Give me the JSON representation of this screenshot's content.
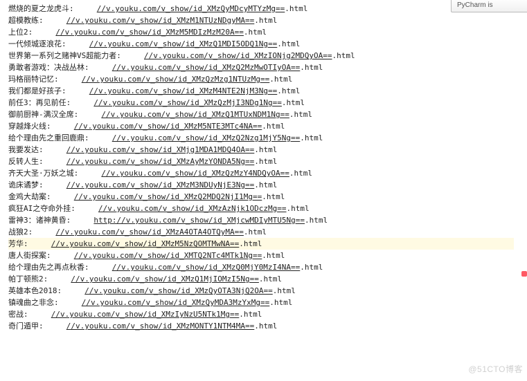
{
  "top_button": "PyCharm is",
  "watermark": "@51CTO博客",
  "lines": [
    {
      "title": "燃烧的夏之龙虎斗",
      "url": "//v.youku.com/v_show/id_XMzQyMDcyMTYzMg==",
      "ext": ".html"
    },
    {
      "title": "超模教练",
      "url": "//v.youku.com/v_show/id_XMzM1NTUzNDgyMA==",
      "ext": ".html"
    },
    {
      "title": "上位2",
      "url": "//v.youku.com/v_show/id_XMzM5MDIzMzM20A==",
      "ext": ".html"
    },
    {
      "title": "一代倾城逐浪花",
      "url": "//v.youku.com/v_show/id_XMzQ1MDI5ODQ1Ng==",
      "ext": ".html"
    },
    {
      "title": "世界第一系列之赌神VS超能力者",
      "url": "//v.youku.com/v_show/id_XMzIONjg2MDQyOA==",
      "ext": ".html"
    },
    {
      "title": "勇敢者游戏：决战丛林",
      "url": "//v.youku.com/v_show/id_XMzQ2MzMwOTIyOA==",
      "ext": ".html"
    },
    {
      "title": "玛格丽特记忆",
      "url": "//v.youku.com/v_show/id_XMzQzMzg1NTUzMg==",
      "ext": ".html"
    },
    {
      "title": "我们都是好孩子",
      "url": "//v.youku.com/v_show/id_XMzM4NTE2NjM3Ng==",
      "ext": ".html"
    },
    {
      "title": "前任3：再见前任",
      "url": "//v.youku.com/v_show/id_XMzQzMjI3NDg1Ng==",
      "ext": ".html"
    },
    {
      "title": "御前厨神-满汉全席",
      "url": "//v.youku.com/v_show/id_XMzQ1MTUxNDM1Ng==",
      "ext": ".html"
    },
    {
      "title": "穿越烽火线",
      "url": "//v.youku.com/v_show/id_XMzM5NTE3MTc4NA==",
      "ext": ".html"
    },
    {
      "title": "给个理由先之重回鹿鼎",
      "url": "//v.youku.com/v_show/id_XMzQ2Nzg1MjY5Ng==",
      "ext": ".html"
    },
    {
      "title": "我要发达",
      "url": "//v.youku.com/v_show/id_XMjg1MDA1MDQ4OA==",
      "ext": ".html"
    },
    {
      "title": "反转人生",
      "url": "//v.youku.com/v_show/id_XMzAyMzYONDA5Ng==",
      "ext": ".html"
    },
    {
      "title": "齐天大圣·万妖之城",
      "url": "//v.youku.com/v_show/id_XMzQzMzY4NDQyOA==",
      "ext": ".html"
    },
    {
      "title": "诡床谲梦",
      "url": "//v.youku.com/v_show/id_XMzM3NDUyNjE3Ng==",
      "ext": ".html"
    },
    {
      "title": "金鸡大劫案",
      "url": "//v.youku.com/v_show/id_XMzQ2MDQ2NjI1Mg==",
      "ext": ".html"
    },
    {
      "title": "疯狂AI之夺命外挂",
      "url": "//v.youku.com/v_show/id_XMzAzNjk1ODczMg==",
      "ext": ".html"
    },
    {
      "title": "雷神3：诸神黄昏",
      "url": "http://v.youku.com/v_show/id_XMjcwMDIyMTU5Ng==",
      "ext": ".html"
    },
    {
      "title": "战狼2",
      "url": "//v.youku.com/v_show/id_XMzA4OTA4OTQyMA==",
      "ext": ".html"
    },
    {
      "title": "芳华",
      "url": "//v.youku.com/v_show/id_XMzM5NzQOMTMwNA==",
      "ext": ".html",
      "highlight": true
    },
    {
      "title": "唐人街探案",
      "url": "//v.youku.com/v_show/id_XMTQ2NTc4MTk1Ng==",
      "ext": ".html"
    },
    {
      "title": "给个理由先之再点秋香",
      "url": "//v.youku.com/v_show/id_XMzQ0MjY0MzI4NA==",
      "ext": ".html"
    },
    {
      "title": "帕丁顿熊2",
      "url": "//v.youku.com/v_show/id_XMzQ1MjIOMzI5Ng==",
      "ext": ".html"
    },
    {
      "title": "英雄本色2018",
      "url": "//v.youku.com/v_show/id_XMzQyOTA3NjQ2OA==",
      "ext": ".html"
    },
    {
      "title": "镇魂曲之非念",
      "url": "//v.youku.com/v_show/id_XMzQyMDA3MzYxMg==",
      "ext": ".html"
    },
    {
      "title": "密战",
      "url": "//v.youku.com/v_show/id_XMzIyNzU5NTk1Mg==",
      "ext": ".html"
    },
    {
      "title": "奇门遁甲",
      "url": "//v.youku.com/v_show/id_XMzMONTY1NTM4MA==",
      "ext": ".html"
    }
  ]
}
